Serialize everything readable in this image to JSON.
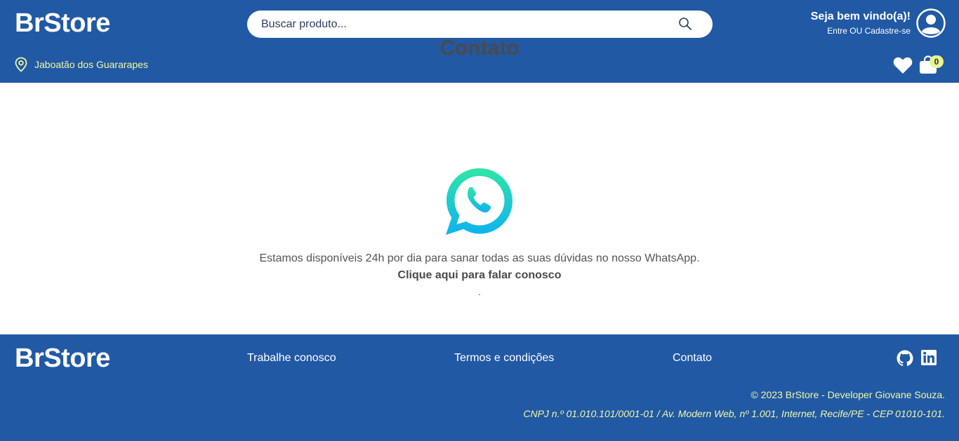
{
  "header": {
    "logo": "BrStore",
    "search_placeholder": "Buscar produto...",
    "welcome_title": "Seja bem vindo(a)!",
    "welcome_sub": "Entre OU Cadastre-se",
    "location": "Jaboatão dos Guararapes",
    "cart_count": "0"
  },
  "main": {
    "title": "Contato",
    "description": "Estamos disponíveis 24h por dia para sanar todas as suas dúvidas no nosso WhatsApp.",
    "cta": "Clique aqui para falar conosco",
    "dot": "."
  },
  "footer": {
    "logo": "BrStore",
    "links": [
      "Trabalhe conosco",
      "Termos e condições",
      "Contato"
    ],
    "copyright": "© 2023 BrStore - Developer Giovane Souza.",
    "cnpj": "CNPJ n.º 01.010.101/0001-01 / Av. Modern Web, nº 1.001, Internet, Recife/PE - CEP 01010-101."
  },
  "icons": {
    "search": "search-icon",
    "user": "user-icon",
    "location": "location-pin-icon",
    "favorites": "heart-icon",
    "cart": "shopping-bag-icon",
    "whatsapp": "whatsapp-icon",
    "github": "github-icon",
    "linkedin": "linkedin-icon"
  },
  "colors": {
    "brand_blue": "#2159a5",
    "accent_yellow": "#f3f7a2",
    "whatsapp_gradient_top": "#2ee6a6",
    "whatsapp_gradient_bottom": "#0fb2f0"
  }
}
